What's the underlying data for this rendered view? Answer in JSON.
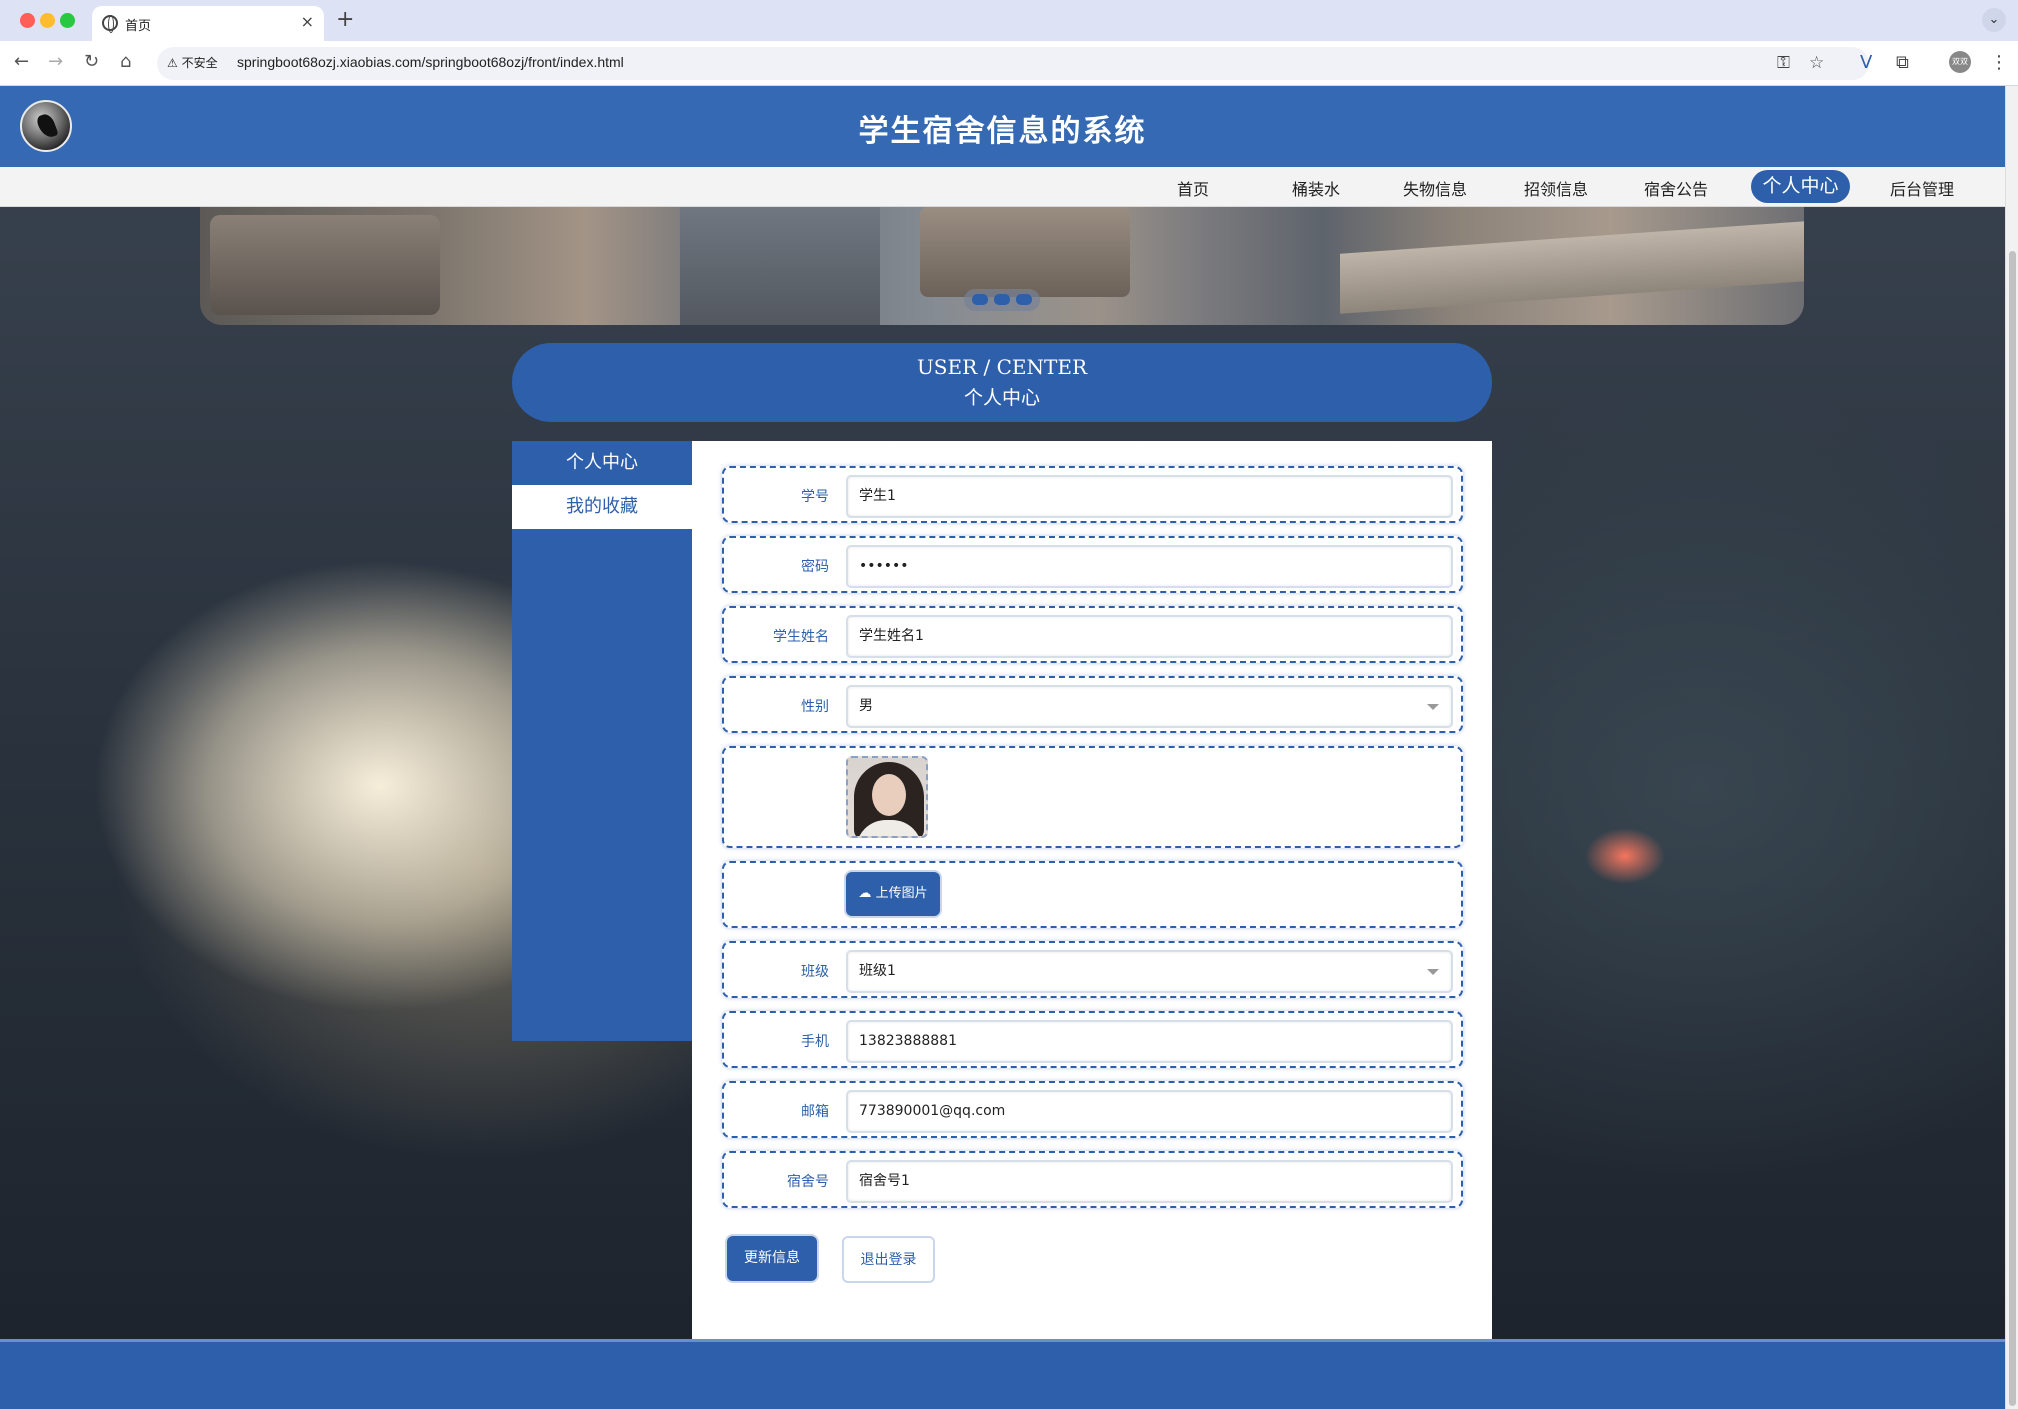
{
  "browser": {
    "tab_title": "首页",
    "tab_close": "×",
    "new_tab": "+",
    "tab_menu": "⌄",
    "insecure_label": "不安全",
    "url": "springboot68ozj.xiaobias.com/springboot68ozj/front/index.html",
    "profile": "双双"
  },
  "header": {
    "title": "学生宿舍信息的系统"
  },
  "nav": {
    "items": [
      "首页",
      "桶装水",
      "失物信息",
      "招领信息",
      "宿舍公告",
      "个人中心",
      "后台管理"
    ],
    "active": "个人中心"
  },
  "user_center": {
    "title_en": "USER / CENTER",
    "title_cn": "个人中心"
  },
  "sidebar": {
    "items": [
      "个人中心",
      "我的收藏"
    ]
  },
  "form": {
    "student_id": {
      "label": "学号",
      "value": "学生1"
    },
    "password": {
      "label": "密码",
      "value": "••••••"
    },
    "student_name": {
      "label": "学生姓名",
      "value": "学生姓名1"
    },
    "gender": {
      "label": "性别",
      "value": "男"
    },
    "upload_label": "上传图片",
    "class": {
      "label": "班级",
      "value": "班级1"
    },
    "phone": {
      "label": "手机",
      "value": "13823888881"
    },
    "email": {
      "label": "邮箱",
      "value": "773890001@qq.com"
    },
    "dorm": {
      "label": "宿舍号",
      "value": "宿舍号1"
    }
  },
  "actions": {
    "update": "更新信息",
    "logout": "退出登录"
  },
  "colors": {
    "primary": "#2d5fab",
    "header": "#3569b4"
  }
}
